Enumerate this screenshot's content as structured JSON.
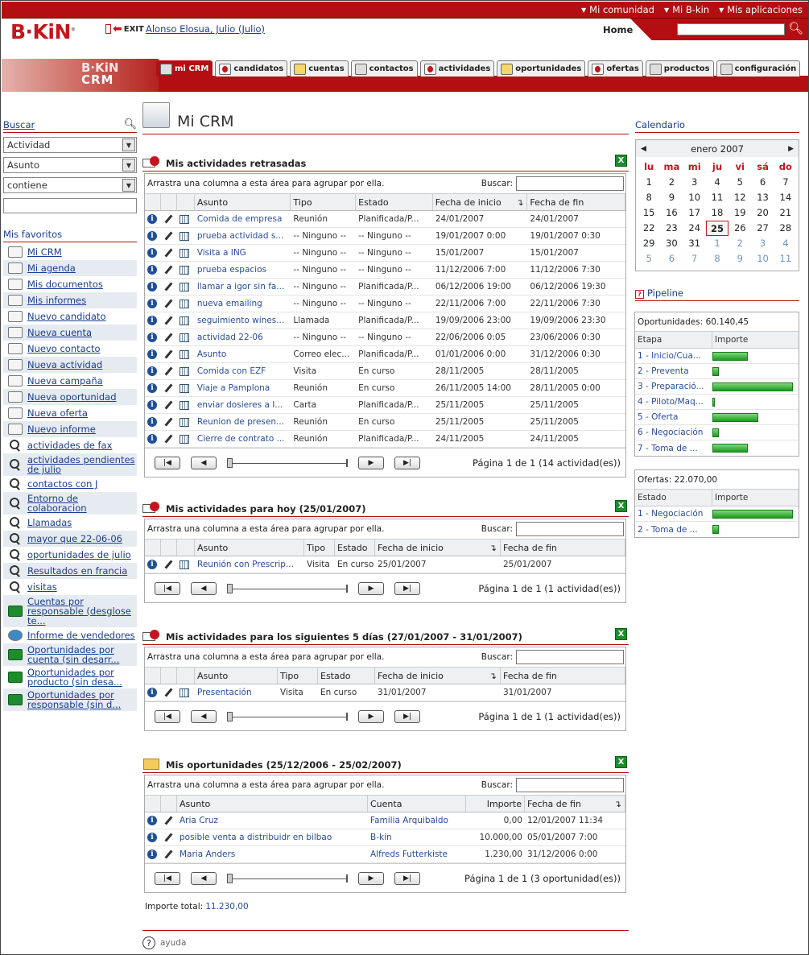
{
  "header": {
    "top_links": [
      "Mi comunidad",
      "Mi B-kin",
      "Mis aplicaciones"
    ],
    "logo_text": "B·KiN",
    "exit_label": "EXIT",
    "user_name": "Alonso Elosua, Julio (Julio)",
    "home_label": "Home",
    "search_value": "",
    "brand_color": "#b30f12"
  },
  "crm_wordmark": {
    "brand": "B·KiN",
    "product": "CRM"
  },
  "tabs": [
    {
      "label": "mi CRM",
      "icon": "monitor-icon",
      "active": true
    },
    {
      "label": "candidatos",
      "icon": "person-icon"
    },
    {
      "label": "cuentas",
      "icon": "folder-icon"
    },
    {
      "label": "contactos",
      "icon": "contact-card-icon"
    },
    {
      "label": "actividades",
      "icon": "calendar-clock-icon"
    },
    {
      "label": "oportunidades",
      "icon": "coins-icon"
    },
    {
      "label": "ofertas",
      "icon": "alert-icon"
    },
    {
      "label": "productos",
      "icon": "box-icon"
    },
    {
      "label": "configuración",
      "icon": "wrench-icon"
    }
  ],
  "left": {
    "search_label": "Buscar",
    "filter_field": "Actividad",
    "filter_attr": "Asunto",
    "filter_op": "contiene",
    "filter_value": "",
    "favorites_label": "Mis favoritos",
    "favorites": [
      {
        "label": "Mi CRM",
        "icon": "monitor-icon"
      },
      {
        "label": "Mi agenda",
        "icon": "agenda-icon"
      },
      {
        "label": "Mis documentos",
        "icon": "document-icon"
      },
      {
        "label": "Mis informes",
        "icon": "report-chart-icon"
      },
      {
        "label": "Nuevo candidato",
        "icon": "new-candidate-icon"
      },
      {
        "label": "Nueva cuenta",
        "icon": "new-account-icon"
      },
      {
        "label": "Nuevo contacto",
        "icon": "new-contact-icon"
      },
      {
        "label": "Nueva actividad",
        "icon": "new-activity-icon"
      },
      {
        "label": "Nueva campaña",
        "icon": "new-campaign-icon"
      },
      {
        "label": "Nueva oportunidad",
        "icon": "new-opportunity-icon"
      },
      {
        "label": "Nueva oferta",
        "icon": "new-offer-icon"
      },
      {
        "label": "Nuevo informe",
        "icon": "new-report-icon"
      },
      {
        "label": "actividades de fax",
        "icon": "search-icon"
      },
      {
        "label": "actividades pendientes de julio",
        "icon": "search-icon"
      },
      {
        "label": "contactos con J",
        "icon": "search-icon"
      },
      {
        "label": "Entorno de colaboracion",
        "icon": "search-icon"
      },
      {
        "label": "Llamadas",
        "icon": "search-icon"
      },
      {
        "label": "mayor que 22-06-06",
        "icon": "search-icon"
      },
      {
        "label": "oportunidades de julio",
        "icon": "search-icon"
      },
      {
        "label": "Resultados en francia",
        "icon": "search-icon"
      },
      {
        "label": "visitas",
        "icon": "search-icon"
      },
      {
        "label": "Cuentas por responsable (desglose te...",
        "icon": "excel-icon"
      },
      {
        "label": "Informe de vendedores",
        "icon": "globe-icon"
      },
      {
        "label": "Oportunidades por cuenta (sin desarr...",
        "icon": "excel-icon"
      },
      {
        "label": "Oportunidades por producto (sin desa...",
        "icon": "excel-icon"
      },
      {
        "label": "Oportunidades por responsable (sin d...",
        "icon": "excel-icon"
      }
    ]
  },
  "page_title": "Mi CRM",
  "grid_common": {
    "group_hint": "Arrastra una columna a esta área para agrupar por ella.",
    "search_label": "Buscar:"
  },
  "panel_late": {
    "title": "Mis actividades retrasadas",
    "columns": [
      "Asunto",
      "Tipo",
      "Estado",
      "Fecha de inicio",
      "Fecha de fin"
    ],
    "rows": [
      [
        "Comida de empresa",
        "Reunión",
        "Planificada/P...",
        "24/01/2007",
        "24/01/2007"
      ],
      [
        "prueba actividad s...",
        "-- Ninguno --",
        "-- Ninguno --",
        "19/01/2007 0:00",
        "19/01/2007 0:30"
      ],
      [
        "Visita a ING",
        "-- Ninguno --",
        "-- Ninguno --",
        "15/01/2007",
        "15/01/2007"
      ],
      [
        "prueba espacios",
        "-- Ninguno --",
        "-- Ninguno --",
        "11/12/2006 7:00",
        "11/12/2006 7:30"
      ],
      [
        "llamar a igor sin fa...",
        "-- Ninguno --",
        "Planificada/P...",
        "06/12/2006 19:00",
        "06/12/2006 19:30"
      ],
      [
        "nueva emailing",
        "-- Ninguno --",
        "-- Ninguno --",
        "22/11/2006 7:00",
        "22/11/2006 7:30"
      ],
      [
        "seguimiento wines...",
        "Llamada",
        "Planificada/P...",
        "19/09/2006 23:00",
        "19/09/2006 23:30"
      ],
      [
        "actividad 22-06",
        "-- Ninguno --",
        "-- Ninguno --",
        "22/06/2006 0:05",
        "23/06/2006 0:30"
      ],
      [
        "Asunto",
        "Correo elec...",
        "Planificada/P...",
        "01/01/2006 0:00",
        "31/12/2006 0:30"
      ],
      [
        "Comida con EZF",
        "Visita",
        "En curso",
        "28/11/2005",
        "28/11/2005"
      ],
      [
        "Viaje a Pamplona",
        "Reunión",
        "En curso",
        "26/11/2005 14:00",
        "28/11/2005 0:00"
      ],
      [
        "enviar dosieres a I...",
        "Carta",
        "Planificada/P...",
        "25/11/2005",
        "25/11/2005"
      ],
      [
        "Reunion de presen...",
        "Reunión",
        "En curso",
        "25/11/2005",
        "25/11/2005"
      ],
      [
        "Cierre de contrato ...",
        "Reunión",
        "Planificada/P...",
        "24/11/2005",
        "24/11/2005"
      ]
    ],
    "page_info": "Página 1 de 1 (14 actividad(es))"
  },
  "panel_today": {
    "title": "Mis actividades para hoy (25/01/2007)",
    "columns": [
      "Asunto",
      "Tipo",
      "Estado",
      "Fecha de inicio",
      "Fecha de fin"
    ],
    "rows": [
      [
        "Reunión con Prescrip...",
        "Visita",
        "En curso",
        "25/01/2007",
        "25/01/2007"
      ]
    ],
    "page_info": "Página 1 de 1 (1 actividad(es))"
  },
  "panel_next": {
    "title": "Mis actividades para los siguientes 5 días (27/01/2007 - 31/01/2007)",
    "columns": [
      "Asunto",
      "Tipo",
      "Estado",
      "Fecha de inicio",
      "Fecha de fin"
    ],
    "rows": [
      [
        "Presentación",
        "Visita",
        "En curso",
        "31/01/2007",
        "31/01/2007"
      ]
    ],
    "page_info": "Página 1 de 1 (1 actividad(es))"
  },
  "panel_opps": {
    "title": "Mis oportunidades (25/12/2006 - 25/02/2007)",
    "columns": [
      "Asunto",
      "Cuenta",
      "Importe",
      "Fecha de fin"
    ],
    "rows": [
      [
        "Aria Cruz",
        "Familia Arquibaldo",
        "0,00",
        "12/01/2007 11:34"
      ],
      [
        "posible venta a distribuidr en bilbao",
        "B-kin",
        "10.000,00",
        "05/01/2007 7:00"
      ],
      [
        "Maria Anders",
        "Alfreds Futterkiste",
        "1.230,00",
        "31/12/2006 0:00"
      ]
    ],
    "page_info": "Página 1 de 1 (3 oportunidad(es))",
    "total_label": "Importe total:",
    "total_value": "11.230,00"
  },
  "calendar": {
    "label": "Calendario",
    "month": "enero 2007",
    "day_names": [
      "lu",
      "ma",
      "mi",
      "ju",
      "vi",
      "sá",
      "do"
    ],
    "days": [
      {
        "d": "1"
      },
      {
        "d": "2"
      },
      {
        "d": "3"
      },
      {
        "d": "4"
      },
      {
        "d": "5"
      },
      {
        "d": "6"
      },
      {
        "d": "7"
      },
      {
        "d": "8"
      },
      {
        "d": "9"
      },
      {
        "d": "10"
      },
      {
        "d": "11"
      },
      {
        "d": "12"
      },
      {
        "d": "13"
      },
      {
        "d": "14"
      },
      {
        "d": "15"
      },
      {
        "d": "16"
      },
      {
        "d": "17"
      },
      {
        "d": "18"
      },
      {
        "d": "19"
      },
      {
        "d": "20"
      },
      {
        "d": "21"
      },
      {
        "d": "22"
      },
      {
        "d": "23"
      },
      {
        "d": "24"
      },
      {
        "d": "25",
        "today": true
      },
      {
        "d": "26"
      },
      {
        "d": "27"
      },
      {
        "d": "28"
      },
      {
        "d": "29"
      },
      {
        "d": "30"
      },
      {
        "d": "31"
      },
      {
        "d": "1",
        "other": true
      },
      {
        "d": "2",
        "other": true
      },
      {
        "d": "3",
        "other": true
      },
      {
        "d": "4",
        "other": true
      },
      {
        "d": "5",
        "other": true
      },
      {
        "d": "6",
        "other": true
      },
      {
        "d": "7",
        "other": true
      },
      {
        "d": "8",
        "other": true
      },
      {
        "d": "9",
        "other": true
      },
      {
        "d": "10",
        "other": true
      },
      {
        "d": "11",
        "other": true
      }
    ]
  },
  "pipeline": {
    "label": "Pipeline",
    "opps_total": "Oportunidades: 60.140,45",
    "col_stage": "Etapa",
    "col_amount": "Importe",
    "stages": [
      {
        "name": "1 - Inicio/Cua...",
        "fraction": 0.44
      },
      {
        "name": "2 - Preventa",
        "fraction": 0.08
      },
      {
        "name": "3 - Preparació...",
        "fraction": 1.0
      },
      {
        "name": "4 - Piloto/Maq...",
        "fraction": 0.03
      },
      {
        "name": "5 - Oferta",
        "fraction": 0.57
      },
      {
        "name": "6 - Negociación",
        "fraction": 0.08
      },
      {
        "name": "7 - Toma de ...",
        "fraction": 0.44
      }
    ],
    "offers_total": "Ofertas: 22.070,00",
    "col_state": "Estado",
    "offer_states": [
      {
        "name": "1 - Negociación",
        "fraction": 1.0
      },
      {
        "name": "2 - Toma de ...",
        "fraction": 0.08
      }
    ]
  },
  "footer": {
    "help_label": "ayuda"
  }
}
